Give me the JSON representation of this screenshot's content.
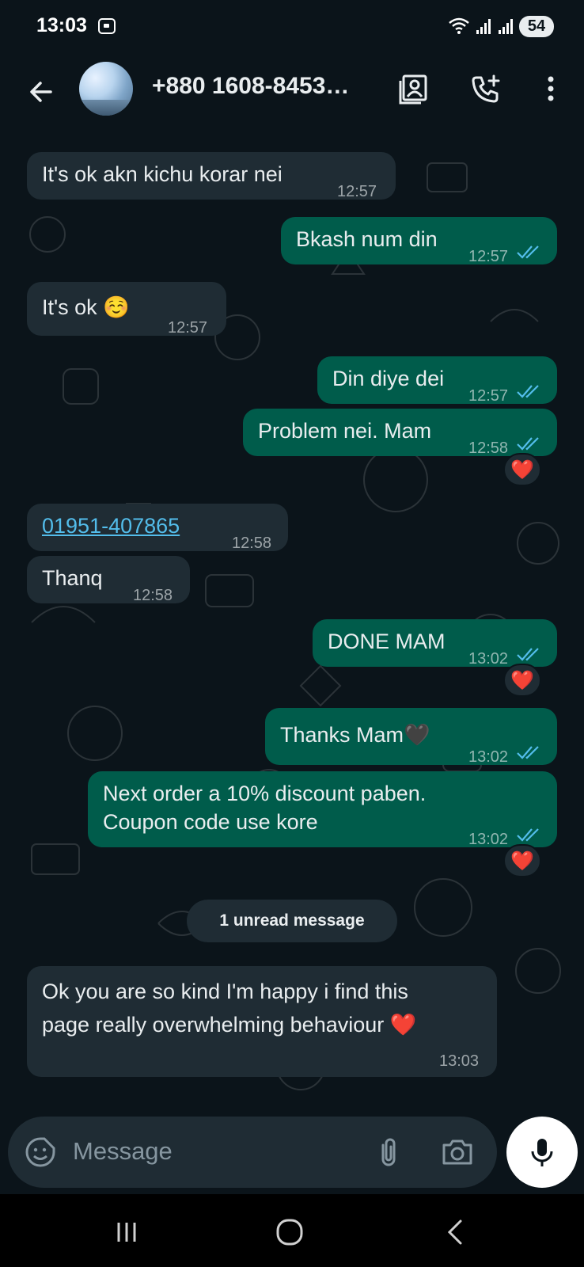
{
  "status_bar": {
    "time": "13:03",
    "battery": "54"
  },
  "header": {
    "contact_name": "+880 1608-8453…"
  },
  "messages": [
    {
      "dir": "in",
      "text": "It's ok akn kichu korar nei",
      "time": "12:57"
    },
    {
      "dir": "out",
      "text": "Bkash num din",
      "time": "12:57",
      "status": "read"
    },
    {
      "dir": "in",
      "text": "It's ok",
      "emoji": "☺️",
      "time": "12:57"
    },
    {
      "dir": "out",
      "text": "Din diye dei",
      "time": "12:57",
      "status": "read"
    },
    {
      "dir": "out",
      "text": "Problem nei. Mam",
      "time": "12:58",
      "status": "read",
      "reaction": "❤️"
    },
    {
      "dir": "in",
      "text": "01951-407865",
      "time": "12:58",
      "is_link": true
    },
    {
      "dir": "in",
      "text": "Thanq",
      "time": "12:58"
    },
    {
      "dir": "out",
      "text": "DONE MAM",
      "time": "13:02",
      "status": "read",
      "reaction": "❤️"
    },
    {
      "dir": "out",
      "text": "Thanks Mam",
      "emoji": "🖤",
      "time": "13:02",
      "status": "read"
    },
    {
      "dir": "out",
      "lines": [
        "Next order a 10% discount paben.",
        "Coupon code use kore"
      ],
      "time": "13:02",
      "status": "read",
      "reaction": "❤️"
    },
    {
      "dir": "in",
      "lines": [
        "Ok you are so kind I'm happy i find this",
        "page really overwhelming behaviour"
      ],
      "emoji": "❤️",
      "time": "13:03"
    }
  ],
  "unread_banner": "1 unread message",
  "input": {
    "placeholder": "Message"
  },
  "colors": {
    "incoming_bubble": "#1f2c34",
    "outgoing_bubble": "#005c4b",
    "read_ticks": "#53bdeb",
    "background": "#0b141a"
  },
  "icons": [
    "back-arrow-icon",
    "contact-card-icon",
    "add-call-icon",
    "more-vert-icon",
    "emoji-sticker-icon",
    "attach-paperclip-icon",
    "camera-icon",
    "microphone-icon",
    "nav-recents-icon",
    "nav-home-icon",
    "nav-back-icon"
  ]
}
